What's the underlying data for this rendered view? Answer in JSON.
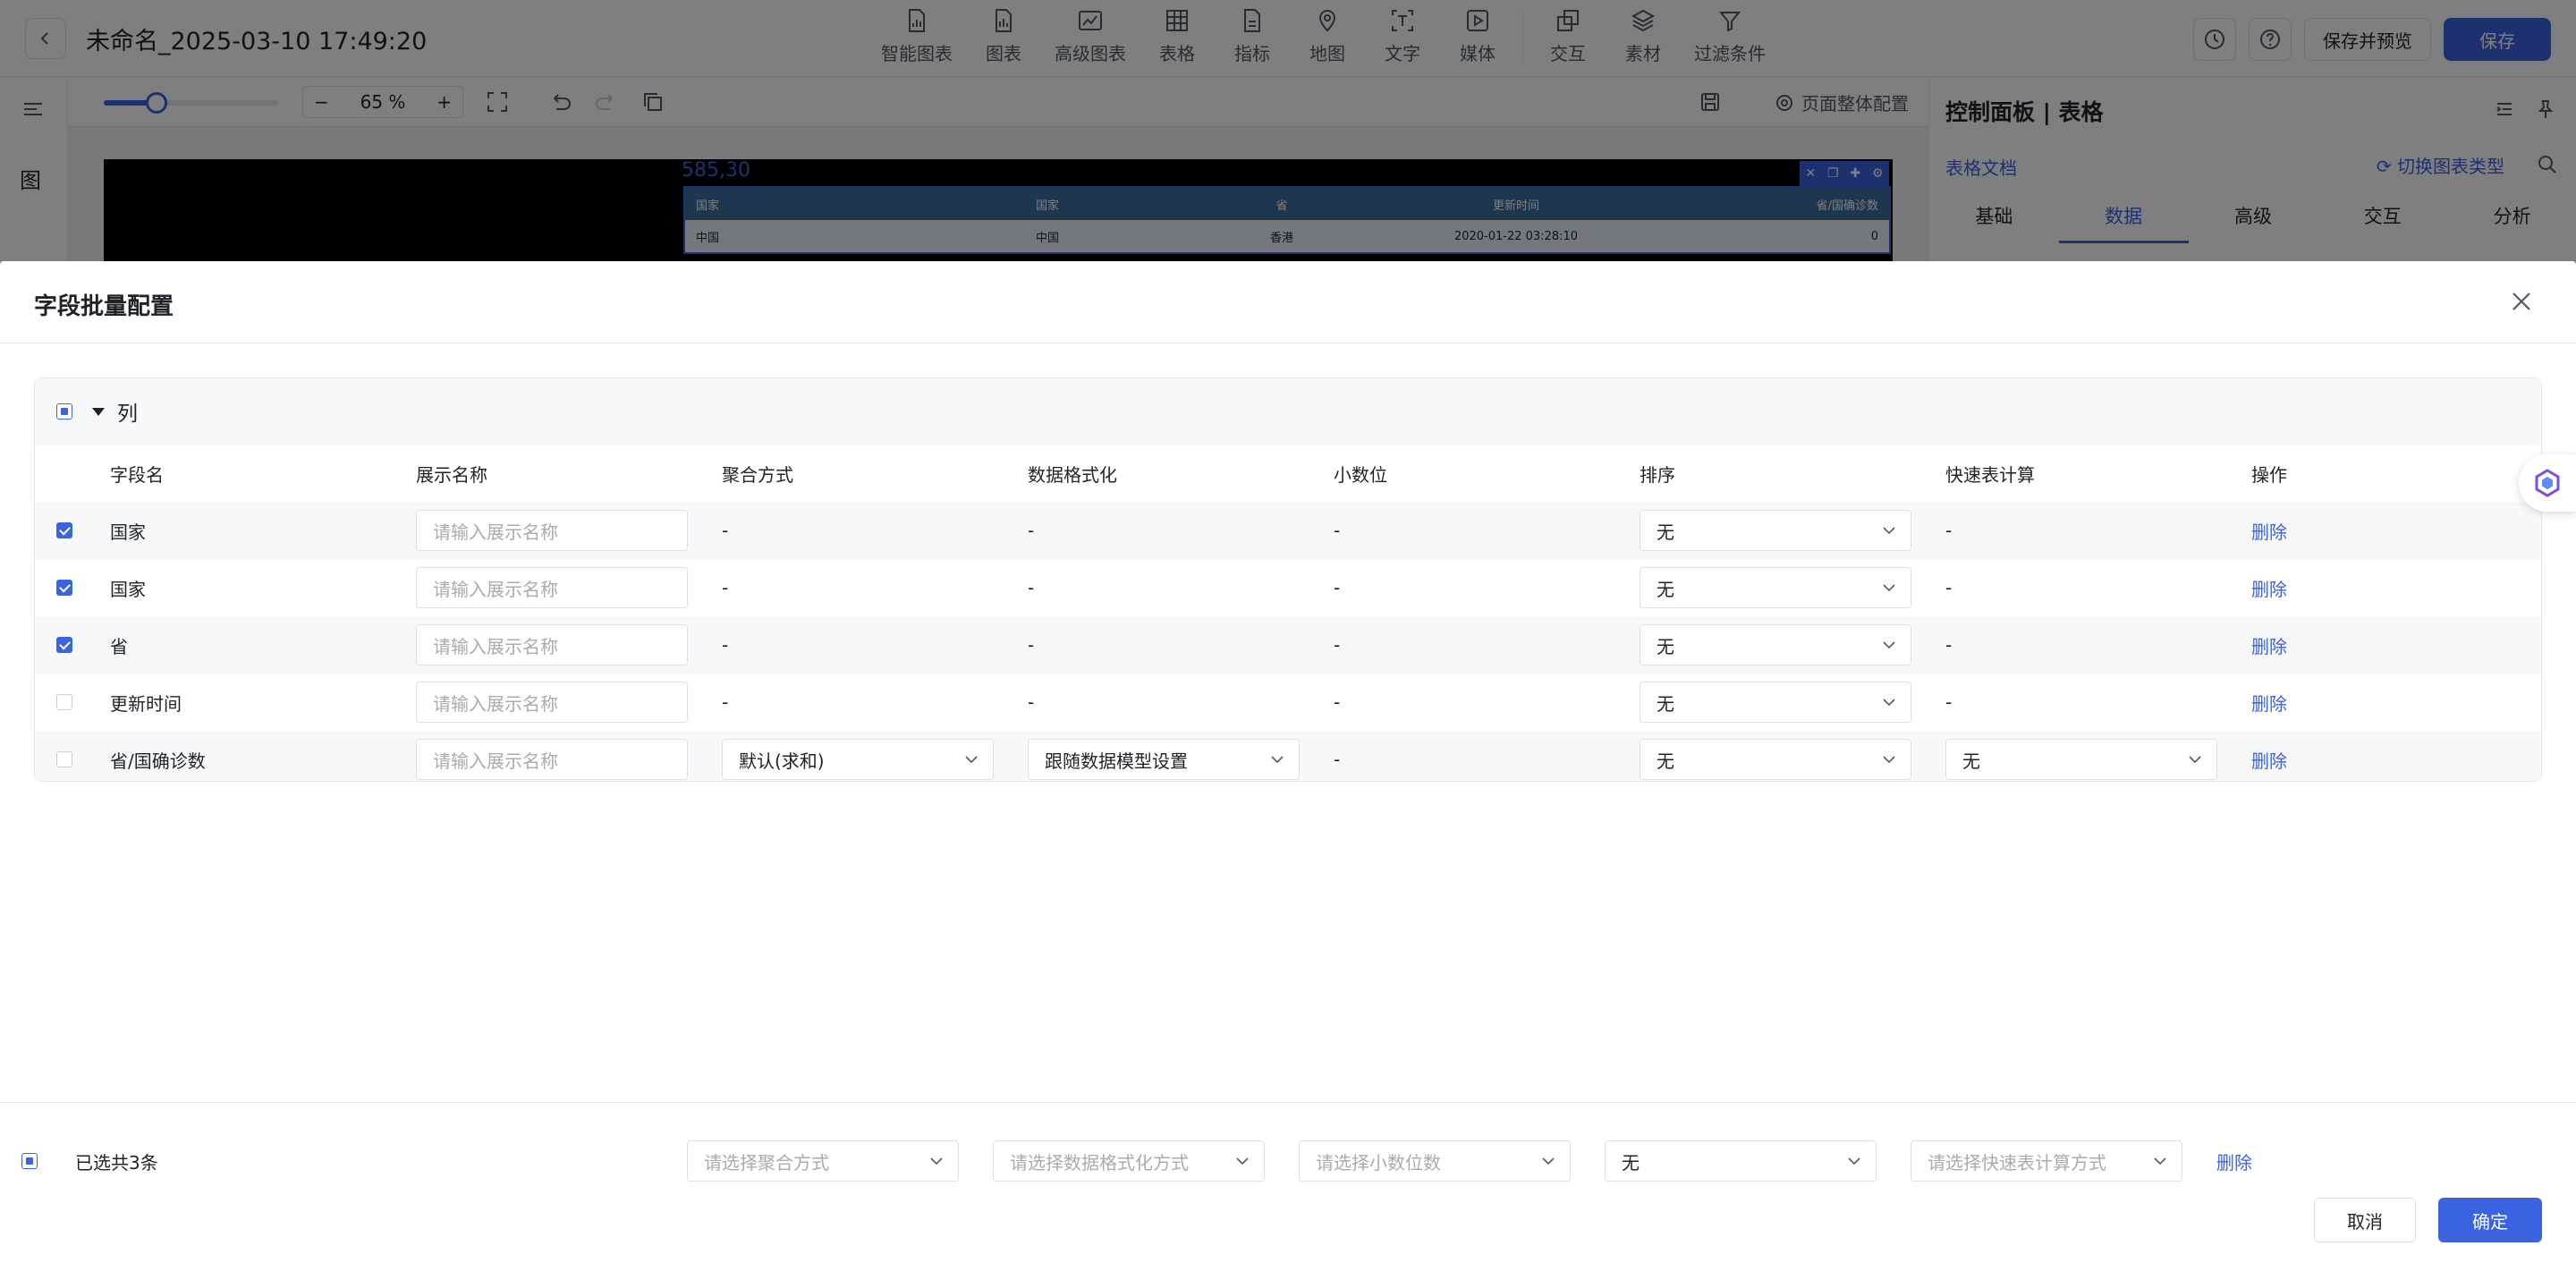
{
  "topbar": {
    "title": "未命名_2025-03-10 17:49:20",
    "tools": [
      {
        "label": "智能图表",
        "icon": "smart-chart-icon"
      },
      {
        "label": "图表",
        "icon": "chart-icon"
      },
      {
        "label": "高级图表",
        "icon": "advanced-chart-icon"
      },
      {
        "label": "表格",
        "icon": "table-icon"
      },
      {
        "label": "指标",
        "icon": "metric-icon"
      },
      {
        "label": "地图",
        "icon": "map-icon"
      },
      {
        "label": "文字",
        "icon": "text-icon"
      },
      {
        "label": "媒体",
        "icon": "media-icon"
      },
      {
        "label": "交互",
        "icon": "interaction-icon"
      },
      {
        "label": "素材",
        "icon": "material-icon"
      },
      {
        "label": "过滤条件",
        "icon": "filter-icon"
      }
    ],
    "save_preview": "保存并预览",
    "save": "保存"
  },
  "leftbar": {
    "label": "图"
  },
  "toolbar2": {
    "zoom": "65 %",
    "zoom_fraction": 0.3,
    "page_config": "页面整体配置"
  },
  "canvas": {
    "coord": "585,30",
    "table_headers": [
      "国家",
      "国家",
      "省",
      "更新时间",
      "省/国确诊数"
    ],
    "table_row": [
      "中国",
      "中国",
      "香港",
      "2020-01-22 03:28:10",
      "0"
    ]
  },
  "panel": {
    "title": "控制面板 | 表格",
    "doc_link": "表格文档",
    "switch_link": "切换图表类型",
    "tabs": [
      "基础",
      "数据",
      "高级",
      "交互",
      "分析"
    ],
    "active_tab": "数据"
  },
  "drawer": {
    "title": "字段批量配置",
    "section_title": "列",
    "columns": [
      "字段名",
      "展示名称",
      "聚合方式",
      "数据格式化",
      "小数位",
      "排序",
      "快速表计算",
      "操作"
    ],
    "rows": [
      {
        "checked": true,
        "field": "国家",
        "display_placeholder": "请输入展示名称",
        "agg": "-",
        "format": "-",
        "decimal": "-",
        "sort": "无",
        "quick": "-",
        "op": "删除"
      },
      {
        "checked": true,
        "field": "国家",
        "display_placeholder": "请输入展示名称",
        "agg": "-",
        "format": "-",
        "decimal": "-",
        "sort": "无",
        "quick": "-",
        "op": "删除"
      },
      {
        "checked": true,
        "field": "省",
        "display_placeholder": "请输入展示名称",
        "agg": "-",
        "format": "-",
        "decimal": "-",
        "sort": "无",
        "quick": "-",
        "op": "删除"
      },
      {
        "checked": false,
        "field": "更新时间",
        "display_placeholder": "请输入展示名称",
        "agg": "-",
        "format": "-",
        "decimal": "-",
        "sort": "无",
        "quick": "-",
        "op": "删除"
      },
      {
        "checked": false,
        "field": "省/国确诊数",
        "display_placeholder": "请输入展示名称",
        "agg": "默认(求和)",
        "format": "跟随数据模型设置",
        "decimal": "-",
        "sort": "无",
        "quick": "无",
        "op": "删除"
      }
    ],
    "footer": {
      "selected_text": "已选共3条",
      "agg_placeholder": "请选择聚合方式",
      "format_placeholder": "请选择数据格式化方式",
      "decimal_placeholder": "请选择小数位数",
      "sort_value": "无",
      "quick_placeholder": "请选择快速表计算方式",
      "delete": "删除",
      "cancel": "取消",
      "confirm": "确定"
    }
  },
  "colors": {
    "primary": "#3b63e0",
    "mask": "rgba(0,0,0,0.5)"
  }
}
